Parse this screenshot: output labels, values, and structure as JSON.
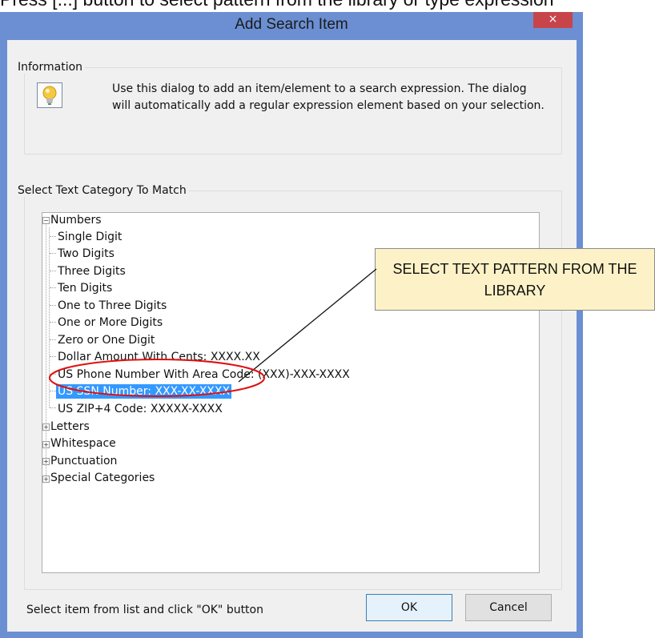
{
  "caption": "Press [...] button to select pattern from the library or type expression",
  "window": {
    "title": "Add Search Item",
    "close_glyph": "×"
  },
  "information": {
    "legend": "Information",
    "icon": "lightbulb-icon",
    "text": "Use this dialog to add an item/element to a search expression. The dialog will automatically add a regular expression element based on your selection."
  },
  "category": {
    "legend": "Select Text Category To Match",
    "tree": [
      {
        "label": "Numbers",
        "expanded": true,
        "children": [
          "Single Digit",
          "Two Digits",
          "Three Digits",
          "Ten Digits",
          "One to Three Digits",
          "One or More Digits",
          "Zero or One Digit",
          "Dollar Amount With Cents: XXXX.XX",
          "US Phone Number With Area Code: (XXX)-XXX-XXXX",
          "US SSN Number: XXX-XX-XXXX",
          "US ZIP+4 Code: XXXXX-XXXX"
        ]
      },
      {
        "label": "Letters",
        "expanded": false
      },
      {
        "label": "Whitespace",
        "expanded": false
      },
      {
        "label": "Punctuation",
        "expanded": false
      },
      {
        "label": "Special Categories",
        "expanded": false
      }
    ],
    "selected_item": "US SSN Number: XXX-XX-XXXX"
  },
  "footer": {
    "status": "Select item from list and click \"OK\" button",
    "ok_label": "OK",
    "cancel_label": "Cancel"
  },
  "callout": {
    "text": "SELECT TEXT PATTERN FROM THE LIBRARY"
  },
  "colors": {
    "window_frame": "#6b8fd2",
    "close_button": "#c7454a",
    "selection": "#3399ff",
    "callout_fill": "#fdf2c7",
    "annotation_ring": "#e01010"
  }
}
